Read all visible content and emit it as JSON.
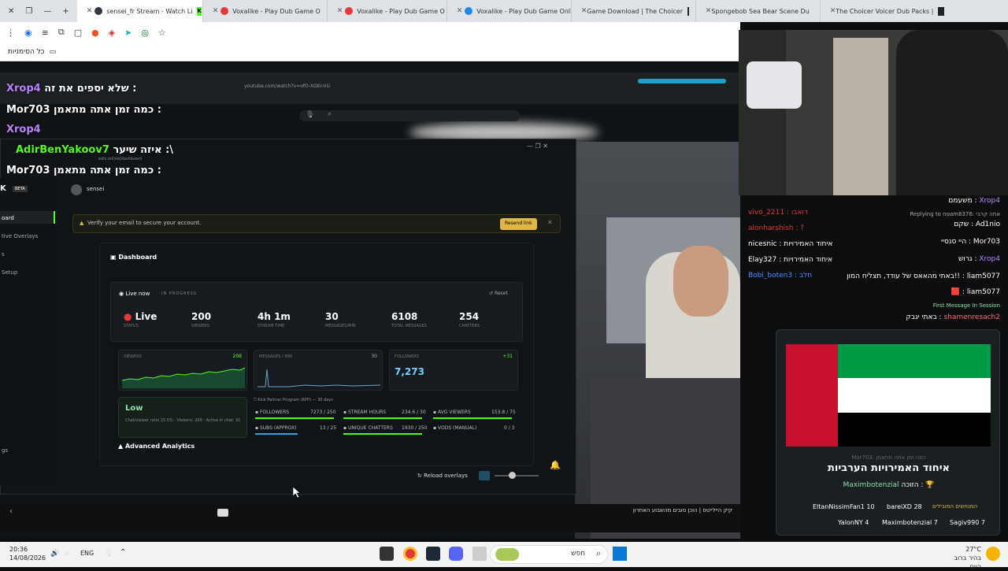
{
  "tabs": [
    {
      "label": "sensei_fr Stream - Watch Li",
      "active": true,
      "badge": "K"
    },
    {
      "label": "Voxalike - Play Dub Game O",
      "active": false
    },
    {
      "label": "Voxalike - Play Dub Game O",
      "active": false
    },
    {
      "label": "Voxalike - Play Dub Game Onli",
      "active": false
    },
    {
      "label": "Game Download | The Choicer",
      "active": false
    },
    {
      "label": "Spongebob Sea Bear Scene Du",
      "active": false
    },
    {
      "label": "The Choicer Voicer Dub Packs |",
      "active": false
    }
  ],
  "bookmarks_label": "כל הסימניות",
  "overlay_chat": [
    {
      "name": "Xrop4",
      "text": "שלא יספים את זה :"
    },
    {
      "name": "Mor703",
      "text": "כמה זמן אתה מתאמן :"
    },
    {
      "name": "Xrop4",
      "text": ""
    },
    {
      "name": "AdirBenYakoov7",
      "text": "איזה שיער :\\"
    },
    {
      "name": "Mor703",
      "text": "כמה זמן אתה מתאמן :"
    }
  ],
  "inner_url": "youtube.com/watch?v=ofO-XGKr-VU",
  "inner_dashboard_url": "edis.online/dashboard",
  "dashboard": {
    "beta": "BETA",
    "user": "sensei",
    "sidebar": [
      "oard",
      "tive Overlays",
      "s",
      "Setup",
      "gs"
    ],
    "verify_text": "Verify your email to secure your account.",
    "resend": "Resend link",
    "title": "Dashboard",
    "live_now": "Live now",
    "in_progress": "IN PROGRESS",
    "reset": "Reset",
    "stats": [
      {
        "value": "Live",
        "label": "STATUS"
      },
      {
        "value": "200",
        "label": "VIEWERS"
      },
      {
        "value": "4h 1m",
        "label": "STREAM TIME"
      },
      {
        "value": "30",
        "label": "MESSAGES/MIN"
      },
      {
        "value": "6108",
        "label": "TOTAL MESSAGES"
      },
      {
        "value": "254",
        "label": "CHATTERS"
      }
    ],
    "viewers_label": "VIEWERS",
    "viewers_value": "208",
    "messages_label": "MESSAGES / MIN",
    "messages_value": "30",
    "followers_label": "FOLLOWERS",
    "followers_delta": "+31",
    "followers_value": "7,273",
    "low": "Low",
    "low_desc": "Chat/viewer ratio 15.5% · Viewers: 200 · Active in chat: 31",
    "kpp_title": "Kick Partner Program (KPP) — 30 days",
    "kpp": [
      {
        "label": "FOLLOWERS",
        "value": "7273 / 250"
      },
      {
        "label": "STREAM HOURS",
        "value": "234.6 / 30"
      },
      {
        "label": "AVG VIEWERS",
        "value": "153.8 / 75"
      },
      {
        "label": "SUBS (APPROX)",
        "value": "13 / 25"
      },
      {
        "label": "UNIQUE CHATTERS",
        "value": "1930 / 250"
      },
      {
        "label": "VODS (MANUAL)",
        "value": "0 / 3"
      }
    ],
    "advanced": "Advanced Analytics",
    "reload": "Reload overlays"
  },
  "right_chat": [
    {
      "name": "Xrop4",
      "text": "משעמם"
    },
    {
      "name": "",
      "text": "Replying to noam8376: אתה קרבי"
    },
    {
      "name": "Ad1nio",
      "text": "שקם"
    },
    {
      "name": "Mor703",
      "text": "היי סנסיי"
    },
    {
      "name": "Xrop4",
      "text": "גרוש"
    },
    {
      "name": "liam5077",
      "text": "באתי מהאאס של עודד, תצליח המון!!"
    },
    {
      "name": "liam5077",
      "text": ""
    },
    {
      "name": "",
      "text": "First Message In Session"
    },
    {
      "name": "shamenresach2",
      "text": "באתי יגבק"
    }
  ],
  "left_overlay_names": [
    "vivo_2211 : דואבו",
    "alonharshish : ?",
    "nicesnic : איחוד האמירויות",
    "Elay327 : איחוד האמירויות",
    "Bobi_boten3 : חלב"
  ],
  "flag_card": {
    "title": "איחוד האמירויות הערביות",
    "winner": "Maximbotenzial",
    "winner_suffix": "הזוכה :",
    "behind": "Mor703: כמה זמן אתה מתאמן",
    "leaders_title": "המנחשים המובילים",
    "leaders": [
      {
        "name": "EltanNissimFan1",
        "score": "10"
      },
      {
        "name": "bareiXD",
        "score": "28"
      },
      {
        "name": "YalonNY",
        "score": "4"
      },
      {
        "name": "Maximbotenzial",
        "score": "7"
      },
      {
        "name": "Sagiv990",
        "score": "7"
      }
    ]
  },
  "ticker": "קיק היילייטס | הוכן סובים מהשבוע האחרון",
  "taskbar": {
    "time": "20:36",
    "date": "14/08/2026",
    "lang": "ENG",
    "search": "חפש",
    "temp": "27°C",
    "weather": "בהיר ברוב היום"
  },
  "colors": {
    "kick_green": "#53fc18",
    "accent_purple": "#b983ff",
    "flag_red": "#c8102e",
    "flag_green": "#009a44"
  }
}
